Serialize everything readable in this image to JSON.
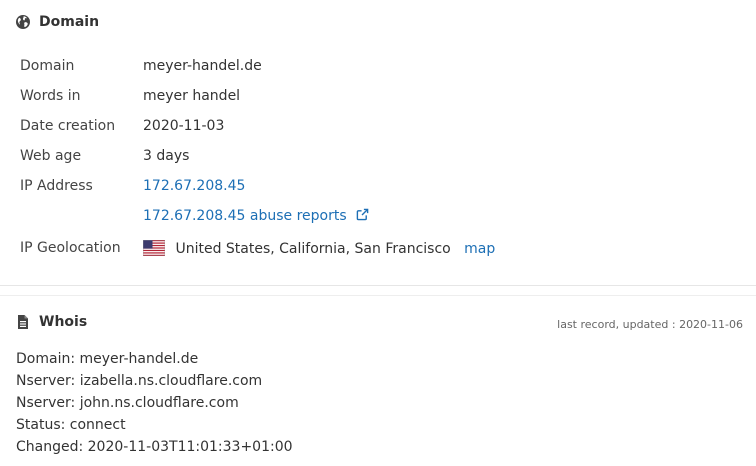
{
  "domain_card": {
    "title": "Domain",
    "rows": {
      "domain": {
        "label": "Domain",
        "value": "meyer-handel.de"
      },
      "words": {
        "label": "Words in",
        "value": "meyer handel"
      },
      "date_creation": {
        "label": "Date creation",
        "value": "2020-11-03"
      },
      "web_age": {
        "label": "Web age",
        "value": "3 days"
      },
      "ip_address": {
        "label": "IP Address",
        "value": "172.67.208.45"
      },
      "abuse": {
        "value": "172.67.208.45 abuse reports"
      },
      "geolocation": {
        "label": "IP Geolocation",
        "value": "United States, California, San Francisco",
        "map_label": "map"
      }
    }
  },
  "whois_card": {
    "title": "Whois",
    "meta": "last record, updated : 2020-11-06",
    "lines": [
      "Domain: meyer-handel.de",
      "Nserver: izabella.ns.cloudflare.com",
      "Nserver: john.ns.cloudflare.com",
      "Status: connect",
      "Changed: 2020-11-03T11:01:33+01:00"
    ]
  },
  "colors": {
    "link": "#1d6fb5",
    "text": "#333333",
    "icon": "#444444"
  }
}
